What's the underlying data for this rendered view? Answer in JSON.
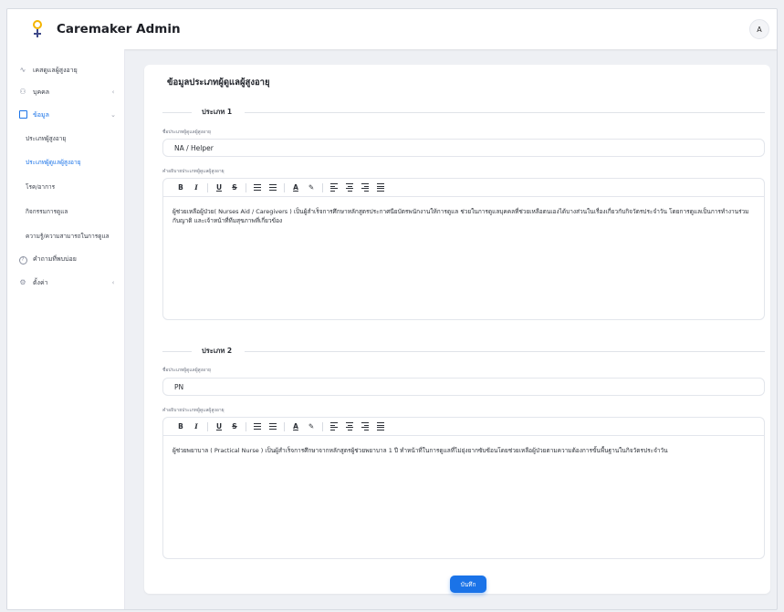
{
  "app": {
    "title": "Caremaker Admin",
    "avatar_initial": "A"
  },
  "sidebar": {
    "items": [
      {
        "label": "เคสดูแลผู้สูงอายุ",
        "icon": "pulse-icon"
      },
      {
        "label": "บุคคล",
        "icon": "users-icon"
      },
      {
        "label": "ข้อมูล",
        "icon": "database-icon"
      },
      {
        "label": "คำถามที่พบบ่อย",
        "icon": "question-icon"
      },
      {
        "label": "ตั้งค่า",
        "icon": "gear-icon"
      }
    ],
    "sub_items": [
      {
        "label": "ประเภทผู้สูงอายุ"
      },
      {
        "label": "ประเภทผู้ดูแลผู้สูงอายุ"
      },
      {
        "label": "โรค/อาการ"
      },
      {
        "label": "กิจกรรมการดูแล"
      },
      {
        "label": "ความรู้/ความสามารถในการดูแล"
      }
    ]
  },
  "main": {
    "title": "ข้อมูลประเภทผู้ดูแลผู้สูงอายุ",
    "name_label": "ชื่อประเภทผู้ดูแลผู้สูงอายุ",
    "desc_label": "คำอธิบายประเภทผู้ดูแลผู้สูงอายุ",
    "sections": [
      {
        "heading": "ประเภท 1",
        "name_value": "NA / Helper",
        "description": "ผู้ช่วยเหลือผู้ป่วย( Nurses Aid / Caregivers ) เป็นผู้สำเร็จการศึกษาหลักสูตรประกาศนียบัตรพนักงานให้การดูแล ช่วยในการดูแลบุคคลที่ช่วยเหลือตนเองได้บางส่วนในเรื่องเกี่ยวกับกิจวัตรประจำวัน โดยการดูแลเป็นการทำงานร่วมกับญาติ และเจ้าหน้าที่ทีมสุขภาพที่เกี่ยวข้อง"
      },
      {
        "heading": "ประเภท 2",
        "name_value": "PN",
        "description": "ผู้ช่วยพยาบาล ( Practical Nurse ) เป็นผู้สำเร็จการศึกษาจากหลักสูตรผู้ช่วยพยาบาล 1 ปี ทำหน้าที่ในการดูแลที่ไม่ยุ่งยากซับซ้อนโดยช่วยเหลือผู้ป่วยตามความต้องการขั้นพื้นฐานในกิจวัตรประจำวัน"
      }
    ],
    "toolbar": {
      "bold": "B",
      "italic": "I",
      "underline": "U",
      "strike": "S",
      "font_color": "A"
    },
    "save_label": "บันทึก"
  }
}
